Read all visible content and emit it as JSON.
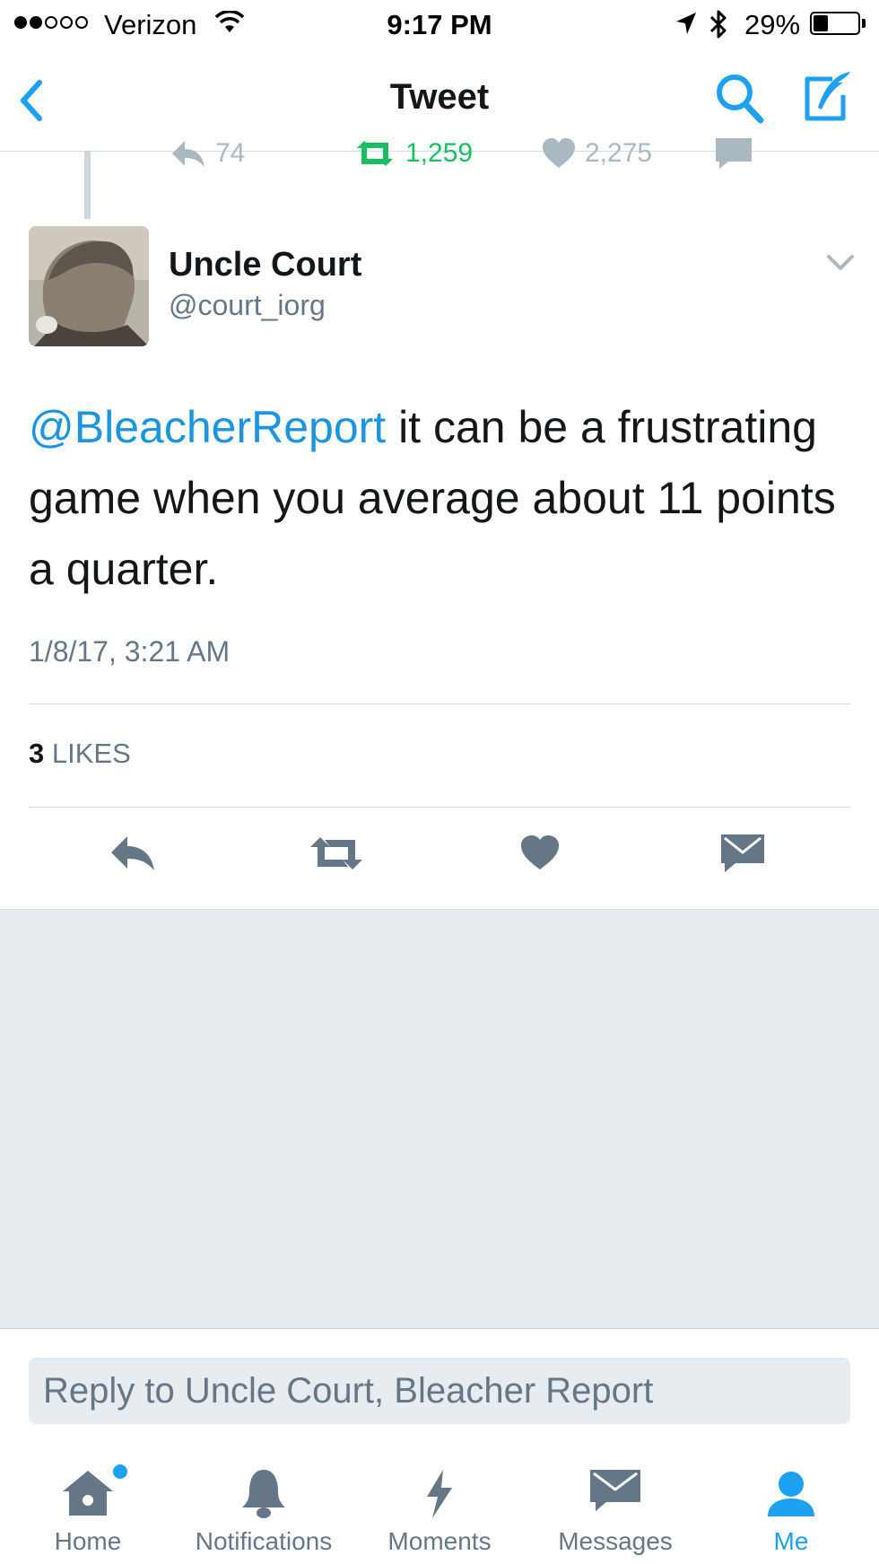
{
  "status_bar": {
    "carrier": "Verizon",
    "time": "9:17 PM",
    "battery": "29%",
    "battery_level": 0.29
  },
  "nav": {
    "title": "Tweet"
  },
  "previous_tweet_actions": {
    "replies": "74",
    "retweets": "1,259",
    "likes": "2,275"
  },
  "tweet": {
    "author_name": "Uncle Court",
    "author_handle": "@court_iorg",
    "mention": "@BleacherReport",
    "text": " it can be a frustrating game when you average about 11 points a quarter.",
    "timestamp": "1/8/17, 3:21 AM",
    "likes_count": "3",
    "likes_label": "LIKES"
  },
  "reply": {
    "placeholder": "Reply to Uncle Court, Bleacher Report"
  },
  "tabs": [
    {
      "label": "Home",
      "icon": "home-icon"
    },
    {
      "label": "Notifications",
      "icon": "bell-icon"
    },
    {
      "label": "Moments",
      "icon": "lightning-icon"
    },
    {
      "label": "Messages",
      "icon": "envelope-icon"
    },
    {
      "label": "Me",
      "icon": "person-icon"
    }
  ],
  "colors": {
    "accent": "#1da1f2",
    "mention": "#1b95e0",
    "retweet_green": "#17bf63",
    "icon_gray": "#657786",
    "background_gray": "#e6ecf0"
  }
}
